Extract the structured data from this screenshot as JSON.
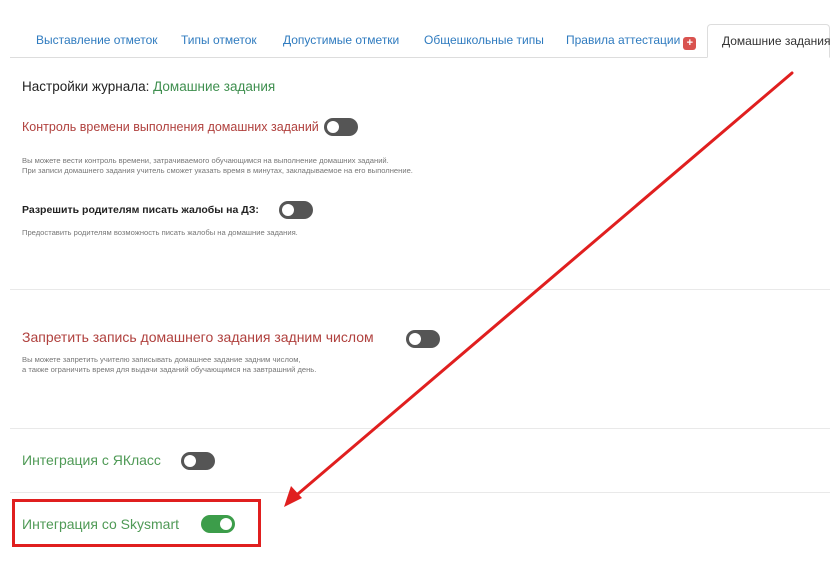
{
  "tabs": [
    {
      "label": "Выставление отметок",
      "active": false
    },
    {
      "label": "Типы отметок",
      "active": false
    },
    {
      "label": "Допустимые отметки",
      "active": false
    },
    {
      "label": "Общешкольные типы",
      "active": false
    },
    {
      "label": "Правила аттестации",
      "active": false,
      "badge_icon": "plus-square-icon"
    },
    {
      "label": "Домашние задания",
      "active": true
    }
  ],
  "page": {
    "title_prefix": "Настройки журнала:",
    "title_section": "Домашние задания"
  },
  "settings": [
    {
      "label": "Контроль времени выполнения домашних заданий",
      "enabled": false,
      "description_lines": [
        "Вы можете вести контроль времени, затрачиваемого обучающимся на выполнение домашних заданий.",
        "При записи домашнего задания учитель сможет указать время в минутах, закладываемое на его выполнение."
      ]
    },
    {
      "label": "Разрешить родителям писать жалобы на ДЗ:",
      "enabled": false,
      "description_lines": [
        "Предоставить родителям возможность писать жалобы на домашние задания."
      ]
    },
    {
      "label": "Запретить запись домашнего задания задним числом",
      "enabled": false,
      "description_lines": [
        "Вы можете запретить учителю записывать домашнее задание задним числом,",
        "а также ограничить время для выдачи заданий обучающимся на завтрашний день."
      ]
    },
    {
      "label": "Интеграция с ЯКласс",
      "enabled": false
    },
    {
      "label": "Интеграция со Skysmart",
      "enabled": true
    }
  ],
  "colors": {
    "link_blue": "#2f7bbf",
    "label_red": "#b0413e",
    "label_green": "#4f9a56",
    "toggle_on": "#3c9d4a",
    "toggle_off": "#555555",
    "annotation_red": "#e01f1f"
  }
}
